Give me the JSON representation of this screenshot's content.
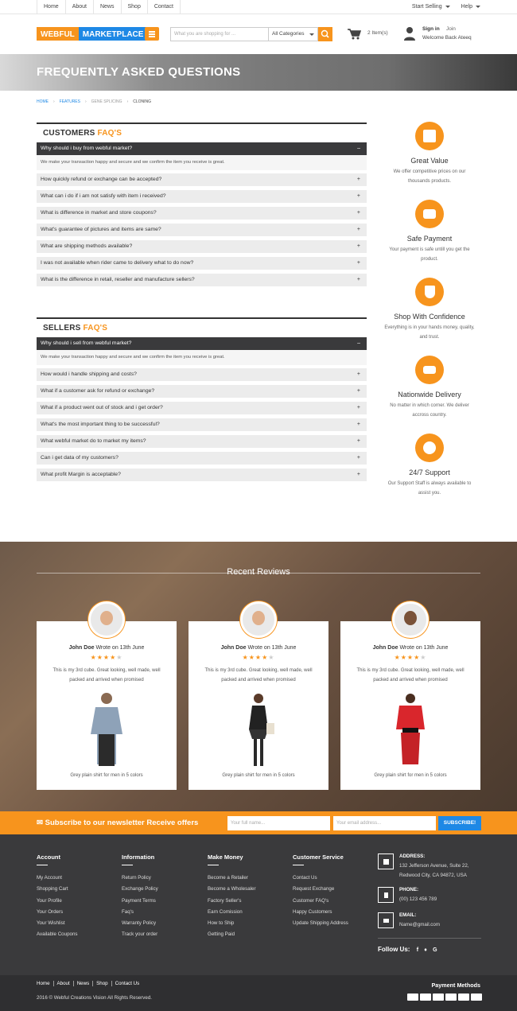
{
  "topnav": {
    "items": [
      "Home",
      "About",
      "News",
      "Shop",
      "Contact"
    ],
    "start_selling": "Start Selling",
    "help": "Help"
  },
  "header": {
    "logo_left": "WEBFUL",
    "logo_right": "MARKETPLACE",
    "search_placeholder": "What you are shopping for ...",
    "category": "All Categories",
    "cart_count": "2 Item(s)",
    "sign_in": "Sign in",
    "join": "Join",
    "welcome": "Welcome Back Ateeq"
  },
  "hero": {
    "title": "FREQUENTLY ASKED QUESTIONS"
  },
  "breadcrumb": [
    "HOME",
    "FEATURES",
    "GENE SPLICING",
    "CLONING"
  ],
  "customers": {
    "title": "CUSTOMERS",
    "title_accent": "FAQ'S",
    "active_q": "Why should i buy from webful market?",
    "active_a": "We make your transaction happy and secure and we confirm the item you receive is great.",
    "questions": [
      "How quickly refund or exchange can be accepted?",
      "What can i do if i am not satisfy with item i received?",
      "What is difference in market and store coupons?",
      "What's guarantee of pictures and items are same?",
      "What are shipping methods available?",
      "I was not available when rider came to delivery what to do now?",
      "What is the difference in retail, reseller and manufacture sellers?"
    ]
  },
  "sellers": {
    "title": "SELLERS",
    "title_accent": "FAQ'S",
    "active_q": "Why should i sell from webful market?",
    "active_a": "We make your transaction happy and secure and we confirm the item you receive is great.",
    "questions": [
      "How would i handle shipping and costs?",
      "What if a customer ask for refund or exchange?",
      "What if a product went out of stock and i get order?",
      "What's the most important thing to be successful?",
      "What webful market do to market my items?",
      "Can i get data of my customers?",
      "What profit Margin is acceptable?"
    ]
  },
  "features": [
    {
      "title": "Great Value",
      "desc": "We offer competitive prices on our thousands products."
    },
    {
      "title": "Safe Payment",
      "desc": "Your payment is safe untill you get the product."
    },
    {
      "title": "Shop With Confidence",
      "desc": "Everything is in your hands money, quality, and trust."
    },
    {
      "title": "Nationwide Delivery",
      "desc": "No matter in which corner. We deliver accross country."
    },
    {
      "title": "24/7 Support",
      "desc": "Our Support Staff is always available to assist you."
    }
  ],
  "reviews": {
    "title": "Recent Reviews",
    "items": [
      {
        "name": "John Doe",
        "wrote": "Wrote on 13th June",
        "rating": 4,
        "text": "This is my 3rd cube. Great looking, well made, well packed and arrived when promised",
        "caption": "Grey plain shirt for men in 5 colors"
      },
      {
        "name": "John Doe",
        "wrote": "Wrote on 13th June",
        "rating": 4,
        "text": "This is my 3rd cube. Great looking, well made, well packed and arrived when promised",
        "caption": "Grey plain shirt for men in 5 colors"
      },
      {
        "name": "John Doe",
        "wrote": "Wrote on 13th June",
        "rating": 4,
        "text": "This is my 3rd cube. Great looking, well made, well packed and arrived when promised",
        "caption": "Grey plain shirt for men in 5 colors"
      }
    ]
  },
  "subscribe": {
    "title": "Subscribe to our newsletter Receive offers",
    "name_placeholder": "Your full name...",
    "email_placeholder": "Your email address...",
    "button": "SUBSCRIBE!"
  },
  "footer": {
    "account": {
      "title": "Account",
      "links": [
        "My Account",
        "Shopping Cart",
        "Your Profile",
        "Your Orders",
        "Your Wishlist",
        "Available Coupons"
      ]
    },
    "information": {
      "title": "Information",
      "links": [
        "Return Policy",
        "Exchange Policy",
        "Payment Terms",
        "Faq's",
        "Warranty Policy",
        "Track your order"
      ]
    },
    "money": {
      "title": "Make Money",
      "links": [
        "Become a Retailer",
        "Become a Wholesaler",
        "Factory Seller's",
        "Earn Comission",
        "How to Ship",
        "Getting Paid"
      ]
    },
    "service": {
      "title": "Customer Service",
      "links": [
        "Contact Us",
        "Request Exchange",
        "Customer FAQ's",
        "Happy Customers",
        "Update Shipping Address"
      ]
    },
    "address_label": "ADDRESS:",
    "address": "132 Jefferson Avenue, Suite 22, Redwood City, CA 94872, USA",
    "phone_label": "PHONE:",
    "phone": "(00) 123 456 789",
    "email_label": "EMAIL:",
    "email": "Name@gmail.com",
    "follow": "Follow Us:"
  },
  "bottom": {
    "nav": [
      "Home",
      "About",
      "News",
      "Shop",
      "Contact Us"
    ],
    "copyright": "2016 © Webful Creations Vision All Rights Reserved.",
    "payment": "Payment Methods",
    "cards": [
      "PayPal",
      "VISA",
      "PayPal",
      "Maestro",
      "MasterCard",
      "Amex"
    ]
  },
  "colors": {
    "accent": "#f7941d",
    "blue": "#1e88e5",
    "dark": "#3a3a3c"
  }
}
